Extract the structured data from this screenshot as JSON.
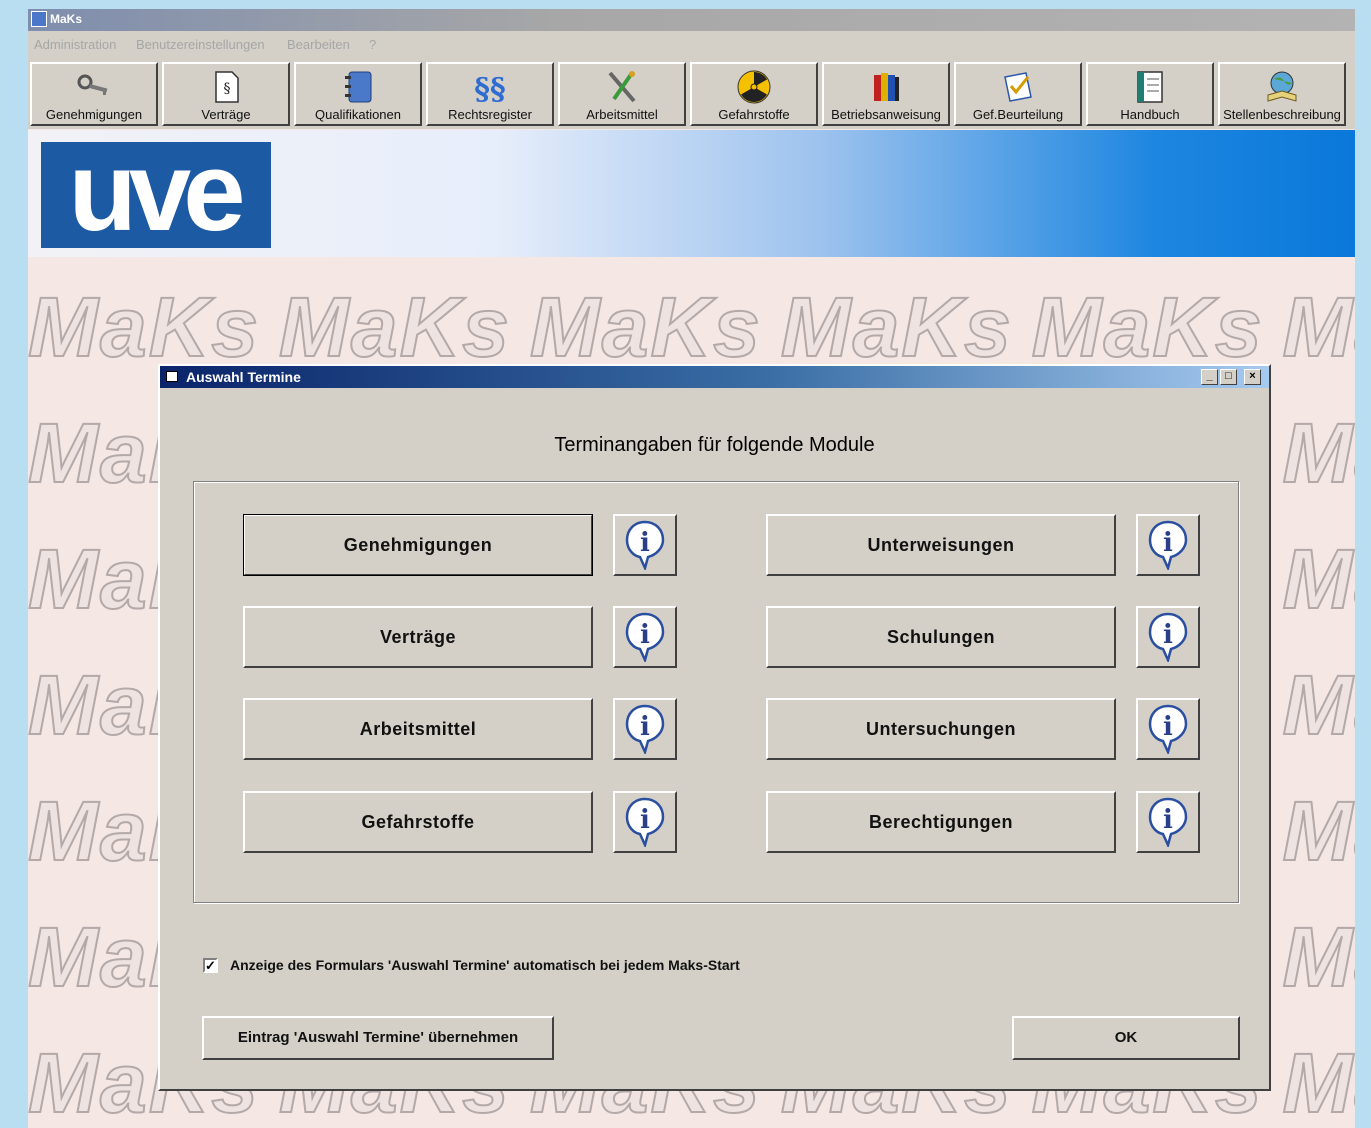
{
  "app": {
    "title": "MaKs"
  },
  "menu": [
    "Administration",
    "Benutzereinstellungen",
    "Bearbeiten",
    "?"
  ],
  "toolbar": [
    {
      "label": "Genehmigungen",
      "icon": "key-icon"
    },
    {
      "label": "Verträge",
      "icon": "document-paragraph-icon"
    },
    {
      "label": "Qualifikationen",
      "icon": "notebook-icon"
    },
    {
      "label": "Rechtsregister",
      "icon": "section-sign-icon"
    },
    {
      "label": "Arbeitsmittel",
      "icon": "tools-icon"
    },
    {
      "label": "Gefahrstoffe",
      "icon": "radiation-icon"
    },
    {
      "label": "Betriebsanweisung",
      "icon": "binders-icon"
    },
    {
      "label": "Gef.Beurteilung",
      "icon": "checklist-icon"
    },
    {
      "label": "Handbuch",
      "icon": "manual-icon"
    },
    {
      "label": "Stellenbeschreibung",
      "icon": "globe-book-icon"
    }
  ],
  "banner": {
    "logo_text": "uve"
  },
  "background": {
    "watermark_text": "MaKs"
  },
  "dialog": {
    "title": "Auswahl Termine",
    "window_buttons": {
      "minimize": "_",
      "maximize": "□",
      "close": "×"
    },
    "heading": "Terminangaben für folgende Module",
    "modules_left": [
      "Genehmigungen",
      "Verträge",
      "Arbeitsmittel",
      "Gefahrstoffe"
    ],
    "modules_right": [
      "Unterweisungen",
      "Schulungen",
      "Untersuchungen",
      "Berechtigungen"
    ],
    "info_icon": "info-icon",
    "checkbox": {
      "checked": true,
      "label": "Anzeige des Formulars 'Auswahl Termine' automatisch bei jedem Maks-Start"
    },
    "apply_button": "Eintrag 'Auswahl Termine' übernehmen",
    "ok_button": "OK"
  },
  "colors": {
    "dialog_title": "#0a246a",
    "banner_blue": "#0a78da",
    "logo_blue": "#1c5aa3",
    "face": "#d4d0c8"
  }
}
